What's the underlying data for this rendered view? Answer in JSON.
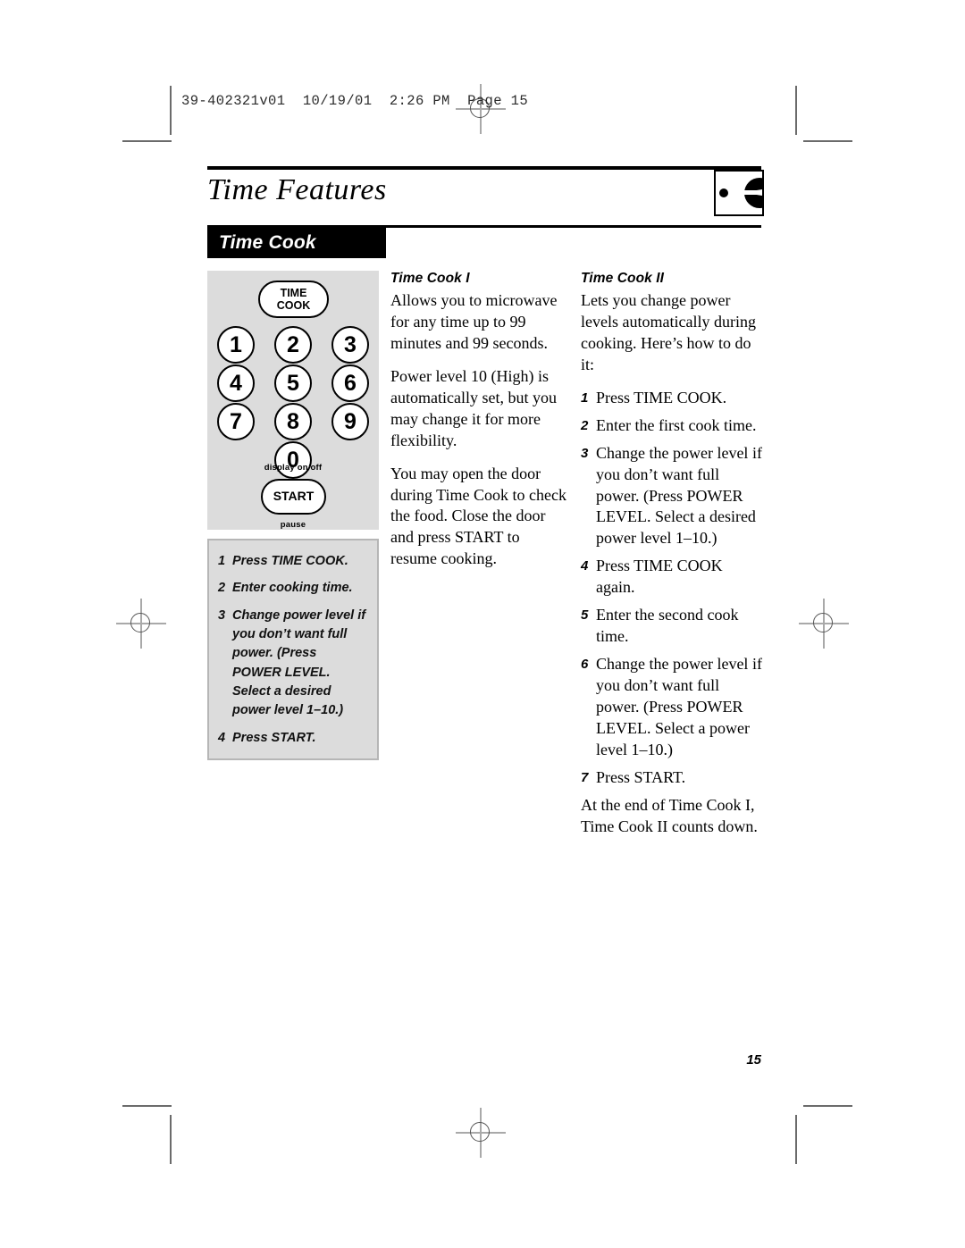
{
  "print_slug": "39-402321v01  10/19/01  2:26 PM  Page 15",
  "header": {
    "chapter_title": "Time Features",
    "corner_icon": "microwave-dial-icon"
  },
  "section": {
    "banner_label": "Time Cook"
  },
  "keypad": {
    "time_cook_button": "TIME\nCOOK",
    "time_cook_line1": "TIME",
    "time_cook_line2": "COOK",
    "keys": [
      "1",
      "2",
      "3",
      "4",
      "5",
      "6",
      "7",
      "8",
      "9"
    ],
    "zero_key": "0",
    "display_label": "display on/off",
    "start_button": "START",
    "pause_label": "pause"
  },
  "steps_box": {
    "steps": [
      {
        "num": "1",
        "text": "Press TIME COOK."
      },
      {
        "num": "2",
        "text": "Enter cooking time."
      },
      {
        "num": "3",
        "text": "Change power level if you don’t want full power. (Press POWER LEVEL. Select a desired power level 1–10.)"
      },
      {
        "num": "4",
        "text": "Press START."
      }
    ]
  },
  "time_cook_1": {
    "heading": "Time Cook I",
    "paragraphs": [
      "Allows you to microwave for any time up to 99 minutes and 99 seconds.",
      "Power level 10 (High) is automatically set, but you may change it for more flexibility.",
      "You may open the door during Time Cook to check the food. Close the door and press START to resume cooking."
    ]
  },
  "time_cook_2": {
    "heading": "Time Cook II",
    "intro": "Lets you change power levels automatically during cooking. Here’s how to do it:",
    "steps": [
      {
        "num": "1",
        "text": "Press TIME COOK."
      },
      {
        "num": "2",
        "text": "Enter the first cook time."
      },
      {
        "num": "3",
        "text": "Change the power level if you don’t want full power. (Press POWER LEVEL. Select a desired power level 1–10.)"
      },
      {
        "num": "4",
        "text": "Press TIME COOK again."
      },
      {
        "num": "5",
        "text": "Enter the second cook time."
      },
      {
        "num": "6",
        "text": "Change the power level if you don’t want full power. (Press POWER LEVEL. Select a power level 1–10.)"
      },
      {
        "num": "7",
        "text": "Press START."
      }
    ],
    "closing": "At the end of Time Cook I, Time Cook II counts down."
  },
  "folio": {
    "page_number": "15"
  },
  "colors": {
    "panel_gray": "#dcdcdc",
    "box_border_gray": "#b6b6b6",
    "banner_black": "#000000",
    "crop_mark_gray": "#6b6b6b",
    "registration_gray": "#a9a9a9"
  }
}
